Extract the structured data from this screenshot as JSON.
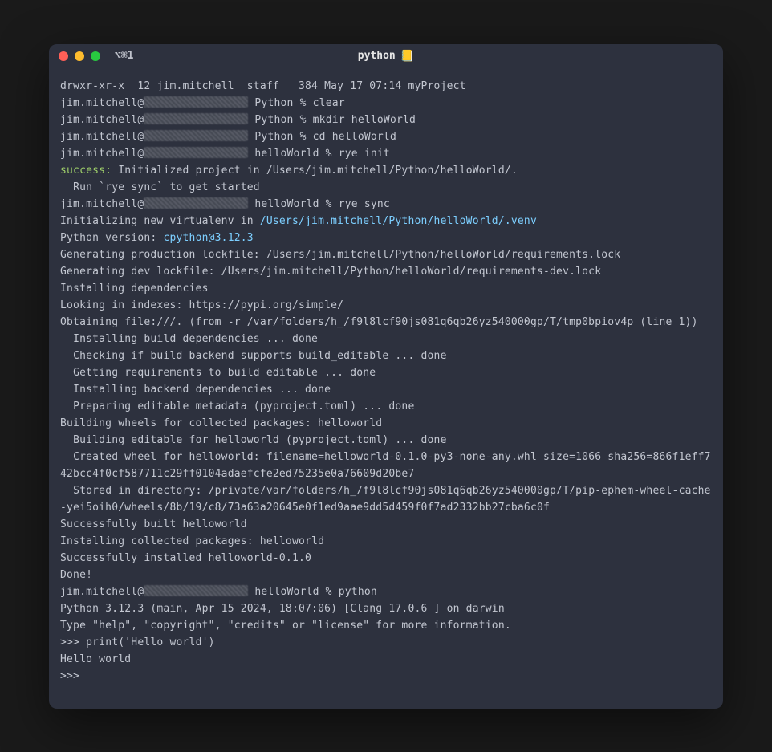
{
  "titlebar": {
    "tab_label": "⌥⌘1",
    "window_title": "python",
    "title_emoji": "📒"
  },
  "traffic_lights": {
    "close_color": "#ff5f57",
    "min_color": "#febc2e",
    "max_color": "#28c840"
  },
  "terminal": {
    "user": "jim.mitchell",
    "host_redacted": true,
    "prompts": {
      "python_dir": "Python %",
      "hello_dir": "helloWorld %",
      "repl": ">>>"
    },
    "ls_line": "drwxr-xr-x  12 jim.mitchell  staff   384 May 17 07:14 myProject",
    "cmd_clear": "clear",
    "cmd_mkdir": "mkdir helloWorld",
    "cmd_cd": "cd helloWorld",
    "cmd_rye_init": "rye init",
    "success_label": "success:",
    "success_rest": "Initialized project in /Users/jim.mitchell/Python/helloWorld/.",
    "run_hint": "  Run `rye sync` to get started",
    "cmd_rye_sync": "rye sync",
    "venv_prefix": "Initializing new virtualenv in ",
    "venv_path": "/Users/jim.mitchell/Python/helloWorld/.venv",
    "pyver_prefix": "Python version: ",
    "pyver_value": "cpython@3.12.3",
    "gen_prod": "Generating production lockfile: /Users/jim.mitchell/Python/helloWorld/requirements.lock",
    "gen_dev": "Generating dev lockfile: /Users/jim.mitchell/Python/helloWorld/requirements-dev.lock",
    "installing_deps": "Installing dependencies",
    "looking_idx": "Looking in indexes: https://pypi.org/simple/",
    "obtaining": "Obtaining file:///. (from -r /var/folders/h_/f9l8lcf90js081q6qb26yz540000gp/T/tmp0bpiov4p (line 1))",
    "sub_build_deps": "  Installing build dependencies ... done",
    "sub_check_backend": "  Checking if build backend supports build_editable ... done",
    "sub_get_reqs": "  Getting requirements to build editable ... done",
    "sub_backend_deps": "  Installing backend dependencies ... done",
    "sub_prepare_meta": "  Preparing editable metadata (pyproject.toml) ... done",
    "build_wheels": "Building wheels for collected packages: helloworld",
    "build_editable": "  Building editable for helloworld (pyproject.toml) ... done",
    "created_wheel": "  Created wheel for helloworld: filename=helloworld-0.1.0-py3-none-any.whl size=1066 sha256=866f1eff742bcc4f0cf587711c29ff0104adaefcfe2ed75235e0a76609d20be7",
    "stored_in": "  Stored in directory: /private/var/folders/h_/f9l8lcf90js081q6qb26yz540000gp/T/pip-ephem-wheel-cache-yei5oih0/wheels/8b/19/c8/73a63a20645e0f1ed9aae9dd5d459f0f7ad2332bb27cba6c0f",
    "built_ok": "Successfully built helloworld",
    "installing_pkgs": "Installing collected packages: helloworld",
    "installed_ok": "Successfully installed helloworld-0.1.0",
    "done": "Done!",
    "cmd_python": "python",
    "repl_banner1": "Python 3.12.3 (main, Apr 15 2024, 18:07:06) [Clang 17.0.6 ] on darwin",
    "repl_banner2": "Type \"help\", \"copyright\", \"credits\" or \"license\" for more information.",
    "repl_input": "print('Hello world')",
    "repl_output": "Hello world",
    "repl_empty": ">>> "
  }
}
